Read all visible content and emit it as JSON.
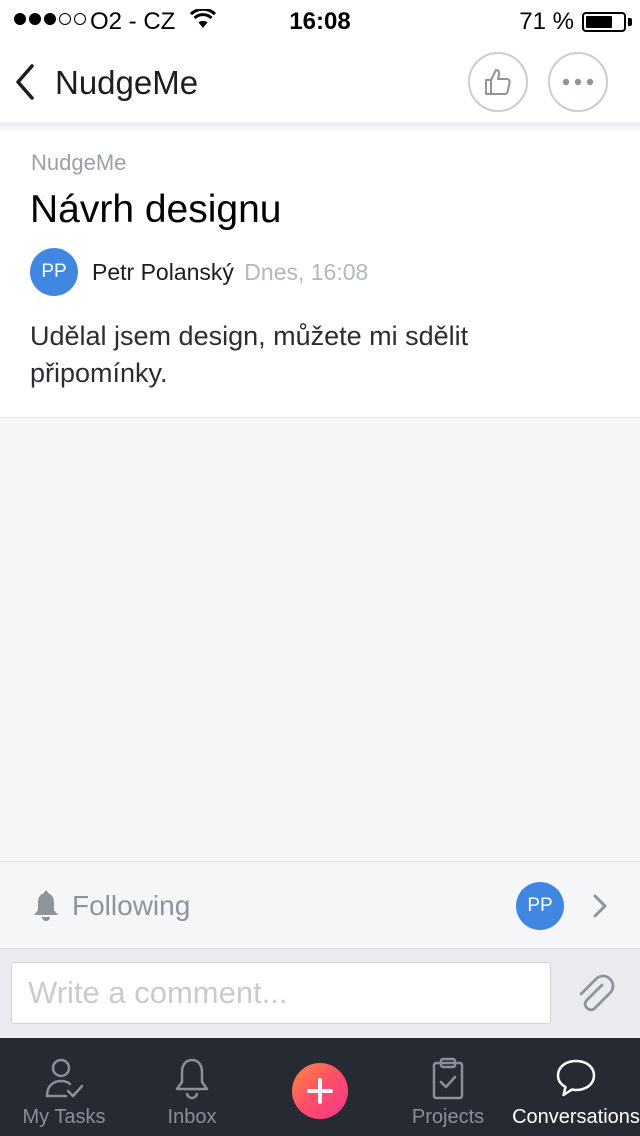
{
  "status_bar": {
    "signal_bars_filled": 3,
    "signal_bars_total": 5,
    "carrier": "O2 - CZ",
    "time": "16:08",
    "battery_percent_label": "71 %",
    "battery_level": 0.71
  },
  "nav": {
    "title": "NudgeMe",
    "back_icon": "chevron-left-icon",
    "like_icon": "thumbs-up-icon",
    "more_icon": "more-horizontal-icon"
  },
  "post": {
    "project": "NudgeMe",
    "title": "Návrh designu",
    "author_initials": "PP",
    "author_name": "Petr Polanský",
    "timestamp": "Dnes, 16:08",
    "body": "Udělal jsem design, můžete mi sdělit připomínky."
  },
  "following": {
    "label": "Following",
    "icon": "bell-icon",
    "follower_initials": "PP"
  },
  "comment": {
    "placeholder": "Write a comment...",
    "value": "",
    "attach_icon": "paperclip-icon"
  },
  "tabs": [
    {
      "label": "My Tasks",
      "icon": "user-check-icon",
      "active": false
    },
    {
      "label": "Inbox",
      "icon": "bell-icon",
      "active": false
    },
    {
      "label": "",
      "icon": "plus-icon",
      "active": false
    },
    {
      "label": "Projects",
      "icon": "clipboard-check-icon",
      "active": false
    },
    {
      "label": "Conversations",
      "icon": "speech-bubble-icon",
      "active": true
    }
  ],
  "colors": {
    "accent_avatar": "#4087e2",
    "tab_bar": "#262a33",
    "add_gradient_start": "#ff8a3d",
    "add_gradient_end": "#f43a8b"
  }
}
